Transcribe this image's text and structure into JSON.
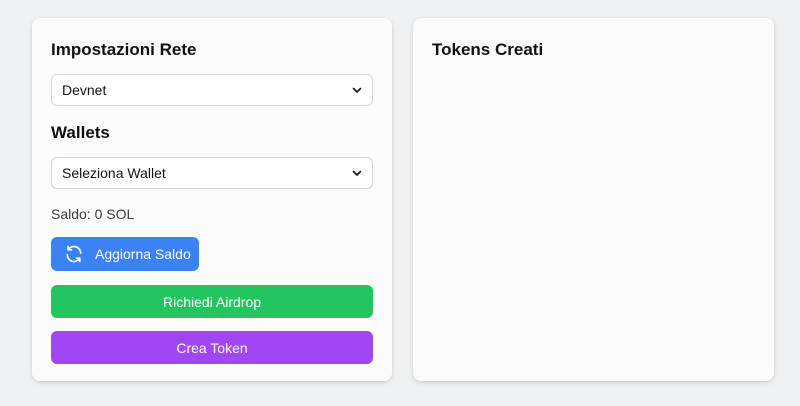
{
  "network": {
    "title": "Impostazioni Rete",
    "selected": "Devnet"
  },
  "wallets": {
    "title": "Wallets",
    "selected": "Seleziona Wallet"
  },
  "balance": {
    "text": "Saldo: 0 SOL"
  },
  "actions": {
    "refresh_label": "Aggiorna Saldo",
    "airdrop_label": "Richiedi Airdrop",
    "create_token_label": "Crea Token"
  },
  "tokens": {
    "title": "Tokens Creati"
  },
  "colors": {
    "refresh_button": "#3b82f6",
    "airdrop_button": "#22c55e",
    "create_token_button": "#a047f3"
  },
  "icons": {
    "refresh": "refresh-icon",
    "chevron": "chevron-down-icon"
  }
}
